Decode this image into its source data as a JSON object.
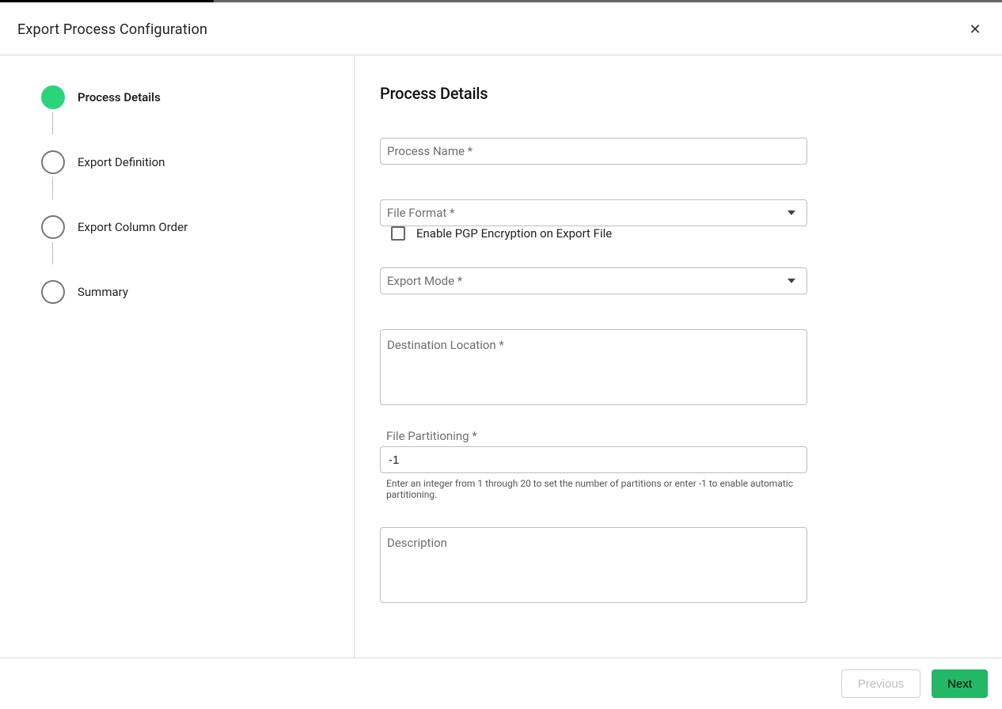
{
  "dialog": {
    "title": "Export Process Configuration"
  },
  "stepper": {
    "steps": [
      {
        "label": "Process Details",
        "active": true
      },
      {
        "label": "Export Definition",
        "active": false
      },
      {
        "label": "Export Column Order",
        "active": false
      },
      {
        "label": "Summary",
        "active": false
      }
    ]
  },
  "content": {
    "heading": "Process Details",
    "fields": {
      "process_name": {
        "label": "Process Name *",
        "value": ""
      },
      "file_format": {
        "label": "File Format *",
        "value": ""
      },
      "pgp_checkbox": {
        "label": "Enable PGP Encryption on Export File",
        "checked": false
      },
      "export_mode": {
        "label": "Export Mode *",
        "value": ""
      },
      "destination": {
        "label": "Destination Location *",
        "value": ""
      },
      "file_partitioning": {
        "label": "File Partitioning *",
        "value": "-1",
        "helper": "Enter an integer from 1 through 20 to set the number of partitions or enter -1 to enable automatic partitioning."
      },
      "description": {
        "label": "Description",
        "value": ""
      }
    }
  },
  "footer": {
    "previous": "Previous",
    "next": "Next"
  }
}
